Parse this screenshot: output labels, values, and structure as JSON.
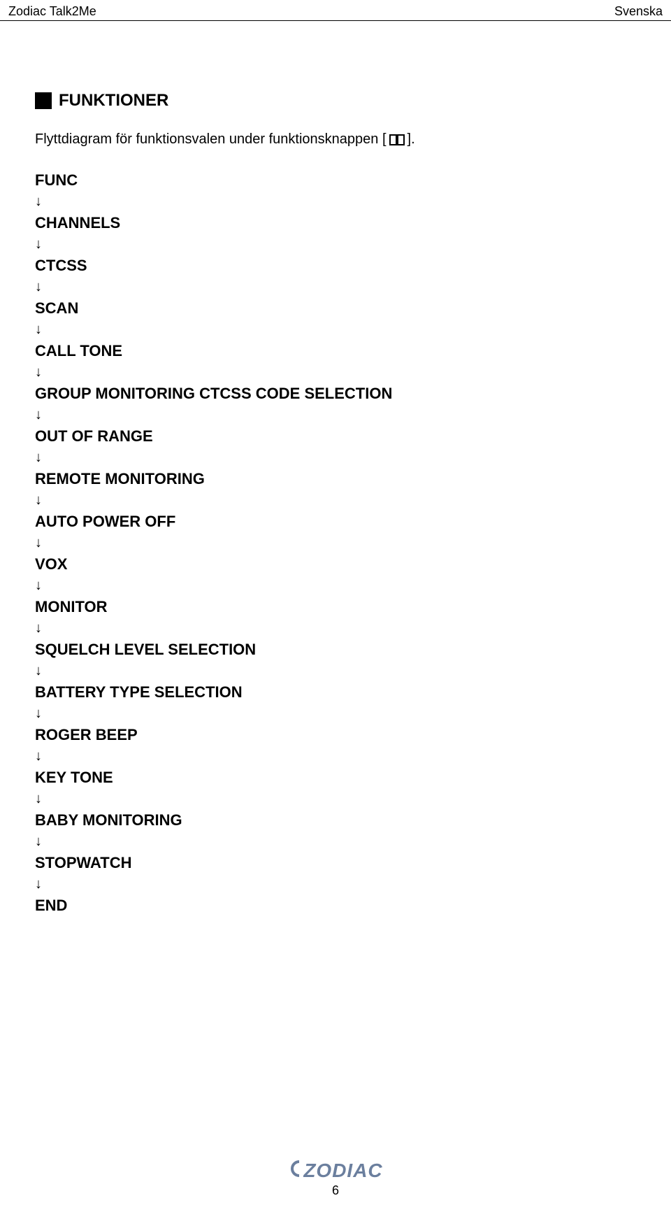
{
  "header": {
    "left": "Zodiac Talk2Me",
    "right": "Svenska"
  },
  "section": {
    "title": "FUNKTIONER",
    "intro_prefix": "Flyttdiagram för funktionsvalen under funktionsknappen [",
    "intro_suffix": "]."
  },
  "flow": [
    "FUNC",
    "CHANNELS",
    "CTCSS",
    "SCAN",
    "CALL TONE",
    "GROUP MONITORING CTCSS CODE SELECTION",
    "OUT OF RANGE",
    "REMOTE MONITORING",
    "AUTO POWER OFF",
    "VOX",
    "MONITOR",
    "SQUELCH LEVEL SELECTION",
    "BATTERY TYPE SELECTION",
    "ROGER BEEP",
    "KEY TONE",
    "BABY MONITORING",
    "STOPWATCH",
    "END"
  ],
  "footer": {
    "logo": "ZODIAC",
    "page_number": "6"
  }
}
